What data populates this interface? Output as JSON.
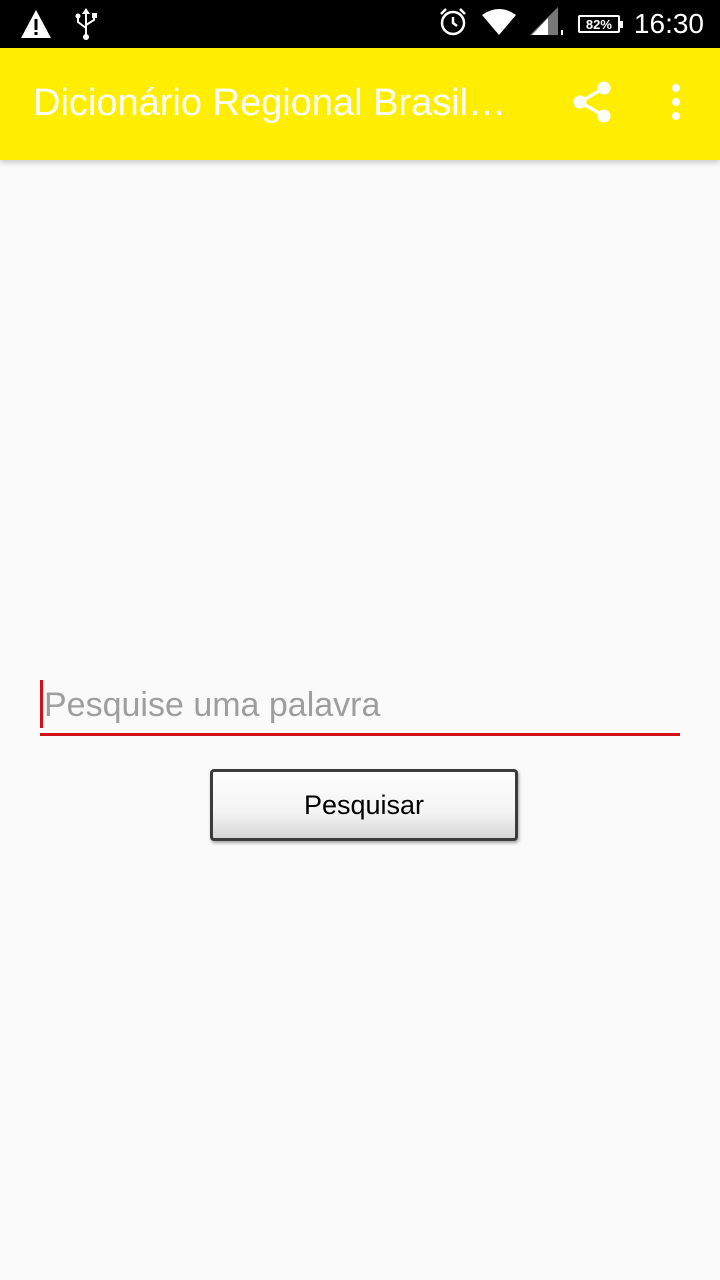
{
  "status_bar": {
    "icons_left": [
      "warning-icon",
      "usb-icon"
    ],
    "icons_right": [
      "alarm-icon",
      "wifi-icon",
      "signal-icon"
    ],
    "battery_label": "82%",
    "time": "16:30"
  },
  "app_bar": {
    "title": "Dicionário Regional Brasileiro",
    "background_color": "#ffee00",
    "actions": [
      "share-icon",
      "more-vert-icon"
    ]
  },
  "search": {
    "placeholder": "Pesquise uma palavra",
    "value": "",
    "underline_color": "#d50f16",
    "button_label": "Pesquisar"
  }
}
